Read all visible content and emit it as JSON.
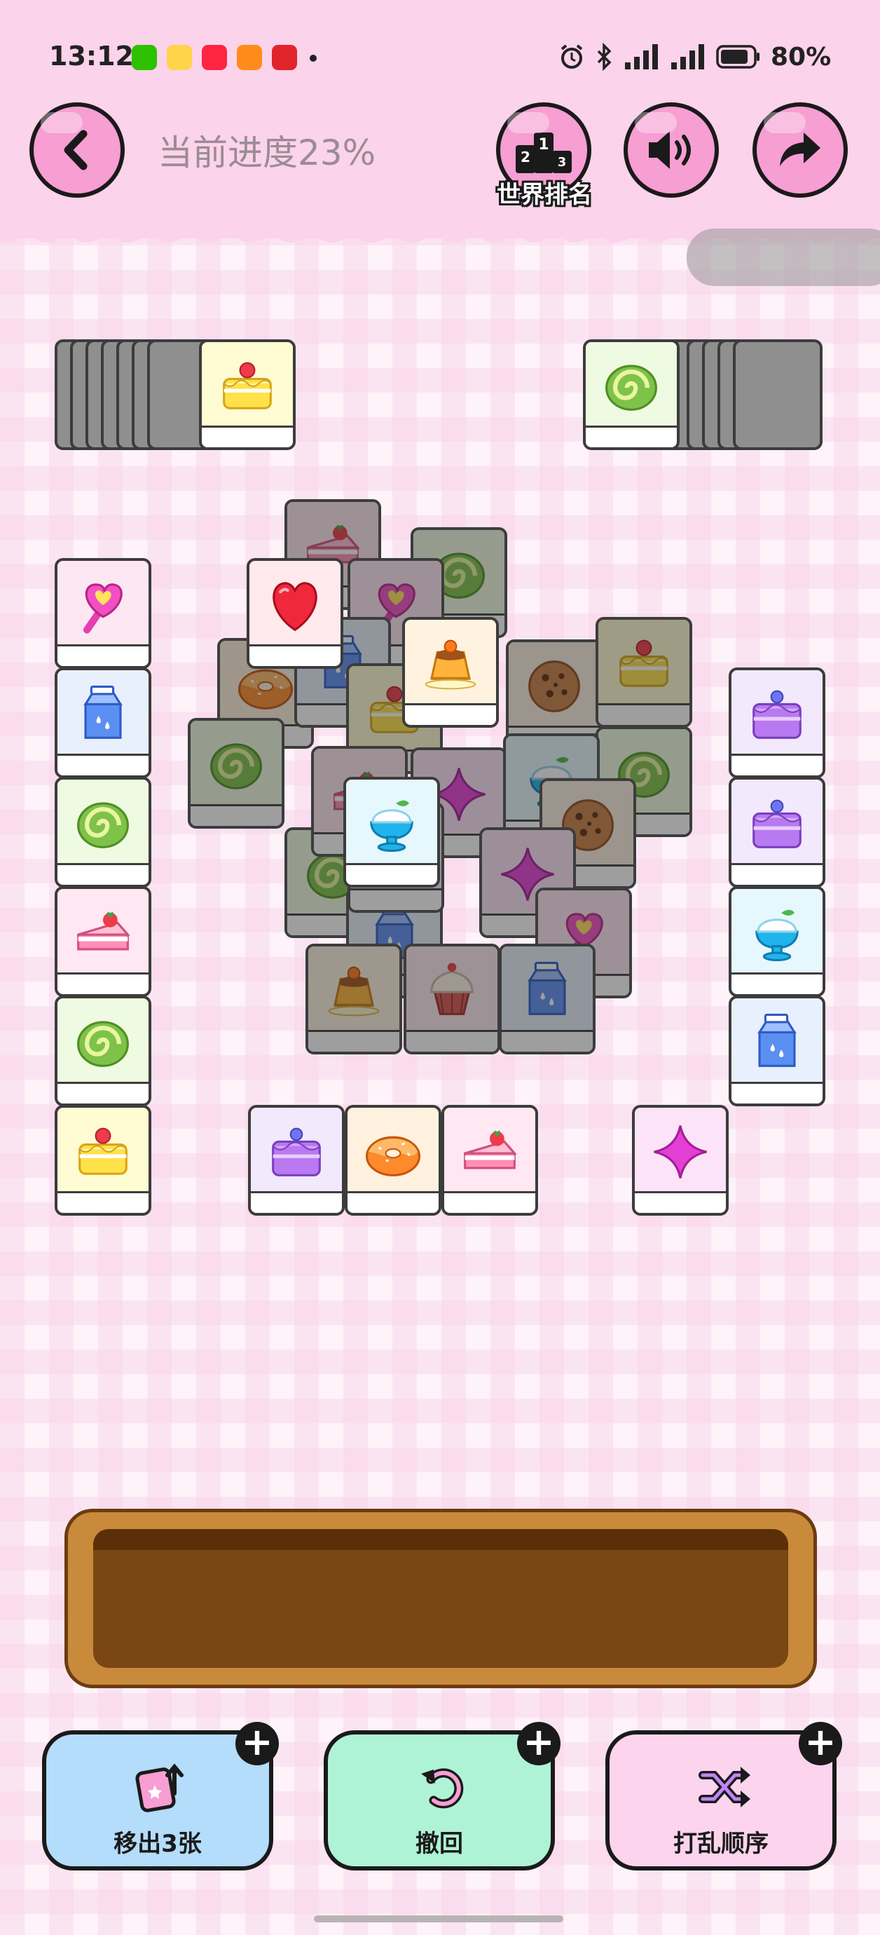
{
  "status_bar": {
    "time": "13:12",
    "battery": "80%"
  },
  "header": {
    "progress": "当前进度23%",
    "rank_label": "世界排名"
  },
  "board": {
    "tile_types": {
      "heart-lollipop": {
        "bg": "#fde7f3"
      },
      "milk": {
        "bg": "#e8f0fe"
      },
      "roll-cake": {
        "bg": "#eefbe2"
      },
      "strawberry-cake": {
        "bg": "#ffe8f1"
      },
      "layer-cake": {
        "bg": "#fffbd2"
      },
      "purple-cake": {
        "bg": "#f2e9fd"
      },
      "ice-cream": {
        "bg": "#e6f8fd"
      },
      "sparkle": {
        "bg": "#fde3f7"
      },
      "donut": {
        "bg": "#fff1dd"
      },
      "pudding": {
        "bg": "#fff3e0"
      },
      "cookie": {
        "bg": "#fbeee0"
      },
      "heart": {
        "bg": "#ffe9ec"
      },
      "cupcake": {
        "bg": "#fde9ef"
      }
    },
    "left_stack_top": "layer-cake",
    "right_stack_top": "roll-cake",
    "left_column": [
      "heart-lollipop",
      "milk",
      "roll-cake",
      "strawberry-cake",
      "roll-cake",
      "layer-cake"
    ],
    "right_column": [
      "purple-cake",
      "purple-cake",
      "ice-cream",
      "milk"
    ],
    "bottom_row": [
      "purple-cake",
      "donut",
      "strawberry-cake"
    ],
    "bottom_single": "sparkle",
    "center_dimmed": [
      "strawberry-cake",
      "roll-cake",
      "heart-lollipop",
      "donut",
      "roll-cake",
      "milk",
      "layer-cake",
      "cookie",
      "layer-cake",
      "roll-cake",
      "sparkle",
      "roll-cake",
      "ice-cream",
      "cookie",
      "roll-cake",
      "sparkle",
      "milk",
      "heart-lollipop",
      "pudding",
      "cupcake",
      "milk",
      "strawberry-cake",
      "purple-cake"
    ],
    "center_active": [
      "heart",
      "pudding",
      "ice-cream"
    ]
  },
  "powerups": {
    "remove": {
      "label": "移出3张",
      "plus": "+"
    },
    "undo": {
      "label": "撤回",
      "plus": "+"
    },
    "shuffle": {
      "label": "打乱顺序",
      "plus": "+"
    }
  }
}
